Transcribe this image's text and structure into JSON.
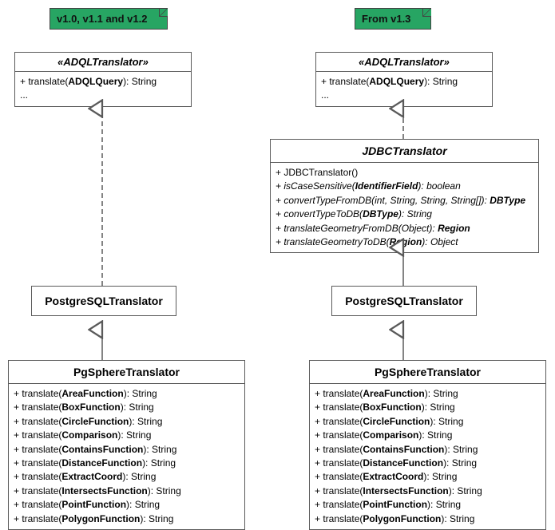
{
  "notes": {
    "left": "v1.0, v1.1 and v1.2",
    "right": "From v1.3"
  },
  "adql_translator": {
    "stereo": "«ADQLTranslator»",
    "methods": [
      {
        "prefix": "+ translate(",
        "param": "ADQLQuery",
        "suffix": "): String"
      },
      {
        "prefix": "...",
        "param": "",
        "suffix": ""
      }
    ]
  },
  "jdbc_translator": {
    "name": "JDBCTranslator",
    "methods": [
      {
        "text": "+ JDBCTranslator()"
      },
      {
        "text": "+ isCaseSensitive(IdentifierField): boolean",
        "ital": true,
        "boldparts": [
          "IdentifierField"
        ]
      },
      {
        "text": "+ convertTypeFromDB(int, String, String, String[]): DBType",
        "ital": true,
        "boldparts": [
          "DBType"
        ]
      },
      {
        "text": "+ convertTypeToDB(DBType): String",
        "ital": true,
        "boldparts": [
          "DBType"
        ]
      },
      {
        "text": "+ translateGeometryFromDB(Object): Region",
        "ital": true,
        "boldparts": [
          "Region"
        ]
      },
      {
        "text": "+ translateGeometryToDB(Region): Object",
        "ital": true,
        "boldparts": [
          "Region"
        ]
      }
    ]
  },
  "postgres": {
    "name": "PostgreSQLTranslator"
  },
  "pgsphere": {
    "name": "PgSphereTranslator",
    "methods": [
      {
        "prefix": "+ translate(",
        "param": "AreaFunction",
        "suffix": "): String"
      },
      {
        "prefix": "+ translate(",
        "param": "BoxFunction",
        "suffix": "): String"
      },
      {
        "prefix": "+ translate(",
        "param": "CircleFunction",
        "suffix": "): String"
      },
      {
        "prefix": "+ translate(",
        "param": "Comparison",
        "suffix": "): String"
      },
      {
        "prefix": "+ translate(",
        "param": "ContainsFunction",
        "suffix": "): String"
      },
      {
        "prefix": "+ translate(",
        "param": "DistanceFunction",
        "suffix": "): String"
      },
      {
        "prefix": "+ translate(",
        "param": "ExtractCoord",
        "suffix": "): String"
      },
      {
        "prefix": "+ translate(",
        "param": "IntersectsFunction",
        "suffix": "): String"
      },
      {
        "prefix": "+ translate(",
        "param": "PointFunction",
        "suffix": "): String"
      },
      {
        "prefix": "+ translate(",
        "param": "PolygonFunction",
        "suffix": "): String"
      }
    ]
  }
}
